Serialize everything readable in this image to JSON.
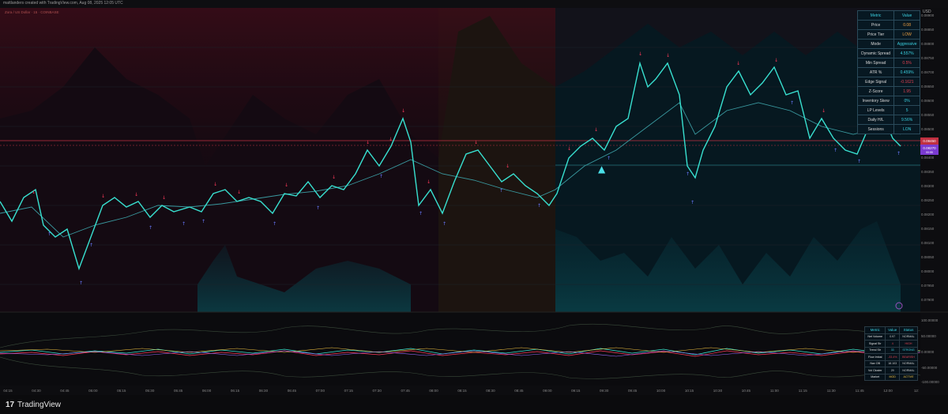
{
  "header": {
    "caption": "mattlanders created with TradingView.com, Aug 08, 2025 12:05 UTC",
    "symbol_legend": "Zora / US Dollar · 15 · COINBASE"
  },
  "price_axis": {
    "currency": "USD",
    "labels": [
      "0.08900",
      "0.08850",
      "0.08800",
      "0.08750",
      "0.08700",
      "0.08650",
      "0.08600",
      "0.08550",
      "0.08500",
      "0.08450",
      "0.08400",
      "0.08350",
      "0.08300",
      "0.08250",
      "0.08200",
      "0.08150",
      "0.08100",
      "0.08050",
      "0.08000",
      "0.07950",
      "0.07900"
    ],
    "last_price": "0.08270",
    "last_price_sub": "00:55"
  },
  "osc_axis": {
    "labels": [
      "100.00000",
      "50.00000",
      "0.00000",
      "-50.00000",
      "-100.00000"
    ]
  },
  "time_axis": {
    "ticks": [
      "04:15",
      "04:30",
      "04:45",
      "05:00",
      "05:15",
      "05:30",
      "05:45",
      "06:00",
      "06:15",
      "06:30",
      "06:45",
      "07:00",
      "07:15",
      "07:30",
      "07:45",
      "08:00",
      "08:15",
      "08:30",
      "08:45",
      "09:00",
      "09:15",
      "09:30",
      "09:45",
      "10:00",
      "10:15",
      "10:30",
      "10:45",
      "11:00",
      "11:15",
      "11:30",
      "11:45",
      "12:00",
      "12:"
    ]
  },
  "metrics_table": {
    "headers": [
      "Metric",
      "Value"
    ],
    "rows": [
      {
        "metric": "Price",
        "value": "0.08",
        "color": "#f0a040"
      },
      {
        "metric": "Price Tier",
        "value": "LOW",
        "color": "#f0a040"
      },
      {
        "metric": "Mode",
        "value": "Aggressive",
        "color": "#3ad0e0"
      },
      {
        "metric": "Dynamic Spread",
        "value": "4.557%",
        "color": "#3ad0e0"
      },
      {
        "metric": "Min Spread",
        "value": "0.5%",
        "color": "#e04050"
      },
      {
        "metric": "ATR %",
        "value": "0.459%",
        "color": "#3ad0e0"
      },
      {
        "metric": "Edge Signal",
        "value": "-0.1621",
        "color": "#e04050"
      },
      {
        "metric": "Z-Score",
        "value": "1.95",
        "color": "#e04050"
      },
      {
        "metric": "Inventory Skew",
        "value": "0%",
        "color": "#3ad0e0"
      },
      {
        "metric": "LP Levels",
        "value": "5",
        "color": "#3ad0e0"
      },
      {
        "metric": "Daily H/L",
        "value": "9.56%",
        "color": "#3ad0e0"
      },
      {
        "metric": "Sessions",
        "value": "LON",
        "color": "#3ad0e0"
      }
    ]
  },
  "status_table": {
    "headers": [
      "Metric",
      "Value",
      "Status"
    ],
    "rows": [
      {
        "metric": "Net Volume",
        "value": "0.97",
        "status": "NORMAL",
        "color": "#d0d0d0"
      },
      {
        "metric": "Signal Str",
        "value": "4",
        "status": "HIGH",
        "color": "#e04050"
      },
      {
        "metric": "Trend Str",
        "value": "33",
        "status": "STRONG",
        "color": "#3ad0e0"
      },
      {
        "metric": "Flow Imbal",
        "value": "-33.4%",
        "status": "BEARISH",
        "color": "#e04050"
      },
      {
        "metric": "Nav OB",
        "value": "18.103",
        "status": "NORMAL",
        "color": "#d0d0d0"
      },
      {
        "metric": "Vol Cluster",
        "value": "29",
        "status": "NORMAL",
        "color": "#d0d0d0"
      },
      {
        "metric": "Market",
        "value": "MOD",
        "status": "ACTIVE",
        "color": "#f0c040"
      }
    ]
  },
  "branding": {
    "logo_mark": "17",
    "logo_text": "TradingView"
  },
  "chart_data": {
    "type": "line",
    "title": "",
    "xlabel": "",
    "ylabel": "",
    "x_range": [
      "04:15",
      "12:05"
    ],
    "ylim": [
      0.079,
      0.089
    ],
    "series": [
      {
        "name": "",
        "points": [
          [
            0,
            0.08218
          ],
          [
            0.03,
            0.0819
          ],
          [
            0.05,
            0.0824
          ],
          [
            0.08,
            0.0816
          ],
          [
            0.1,
            0.0811
          ],
          [
            0.13,
            0.0823
          ],
          [
            0.16,
            0.0822
          ],
          [
            0.19,
            0.0825
          ],
          [
            0.22,
            0.0821
          ],
          [
            0.25,
            0.0826
          ],
          [
            0.28,
            0.0824
          ],
          [
            0.31,
            0.0828
          ],
          [
            0.34,
            0.0826
          ],
          [
            0.37,
            0.0831
          ],
          [
            0.4,
            0.0833
          ],
          [
            0.43,
            0.0847
          ],
          [
            0.45,
            0.0843
          ],
          [
            0.48,
            0.0828
          ],
          [
            0.51,
            0.083
          ],
          [
            0.54,
            0.084
          ],
          [
            0.56,
            0.0837
          ],
          [
            0.58,
            0.083
          ],
          [
            0.61,
            0.0831
          ],
          [
            0.64,
            0.084
          ],
          [
            0.67,
            0.0836
          ],
          [
            0.7,
            0.0844
          ],
          [
            0.73,
            0.0861
          ],
          [
            0.75,
            0.0862
          ],
          [
            0.78,
            0.0828
          ],
          [
            0.81,
            0.0855
          ],
          [
            0.83,
            0.0858
          ],
          [
            0.86,
            0.0846
          ],
          [
            0.89,
            0.0839
          ],
          [
            0.92,
            0.0852
          ],
          [
            0.95,
            0.0853
          ],
          [
            0.97,
            0.0843
          ],
          [
            1.0,
            0.0827
          ]
        ]
      }
    ],
    "signal_marker": "▲",
    "grid": true
  }
}
